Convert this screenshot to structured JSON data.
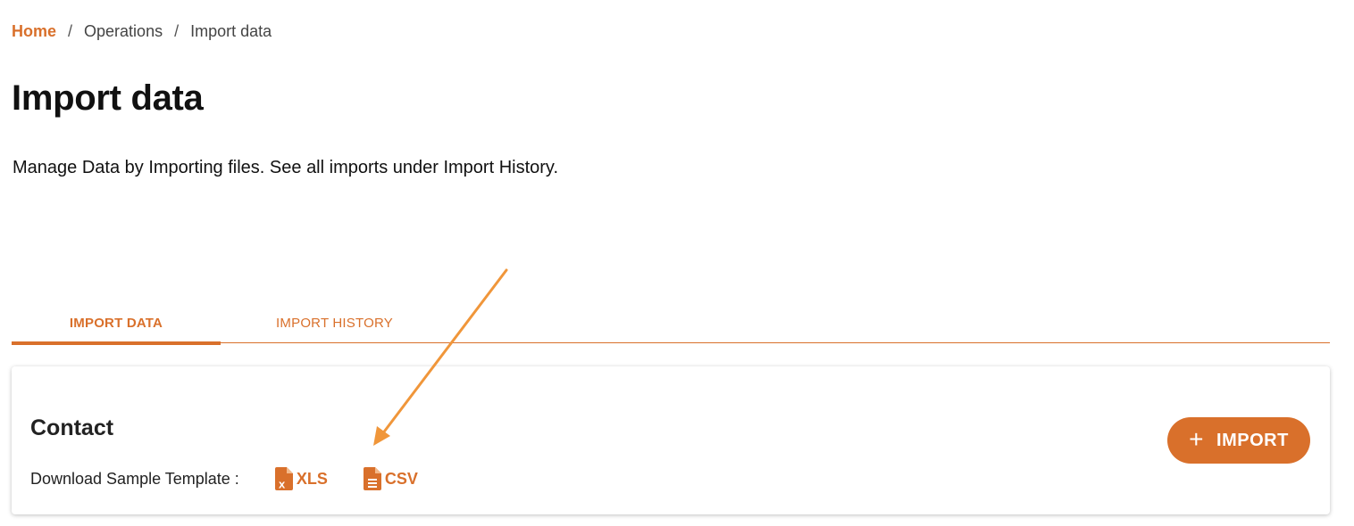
{
  "breadcrumb": {
    "home": "Home",
    "separator": "/",
    "operations": "Operations",
    "current": "Import data"
  },
  "page": {
    "title": "Import data",
    "description": "Manage Data by Importing files. See all imports under Import History."
  },
  "tabs": [
    {
      "label": "IMPORT DATA",
      "active": true
    },
    {
      "label": "IMPORT HISTORY",
      "active": false
    }
  ],
  "card": {
    "title": "Contact",
    "template_label": "Download Sample Template :",
    "xls_label": "XLS",
    "csv_label": "CSV",
    "xls_icon": "xls-file-icon",
    "csv_icon": "csv-file-icon",
    "import_button": {
      "plus": "+",
      "label": "IMPORT"
    }
  },
  "colors": {
    "accent": "#d9702b",
    "annotation_arrow": "#f0963a"
  }
}
